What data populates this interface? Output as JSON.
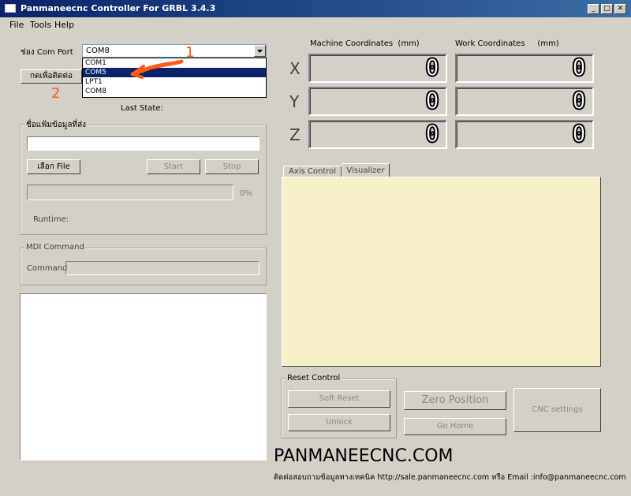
{
  "window": {
    "title": "Panmaneecnc Controller For GRBL 3.4.3"
  },
  "menu": [
    "File",
    "Tools",
    "Help"
  ],
  "connection": {
    "port_label": "ช่อง Com Port",
    "selected_port": "COM8",
    "dropdown_options": [
      "COM1",
      "COM5",
      "LPT1",
      "COM8"
    ],
    "highlighted_index": 1,
    "connect_button": "กดเพื่อติดต่อ",
    "last_state_label": "Last State:",
    "annotation_1": "1",
    "annotation_2": "2"
  },
  "file_group": {
    "legend": "ชื่อแฟ้มข้อมูลที่ส่ง",
    "filename": "",
    "choose_file_button": "เลือก File",
    "start_button": "Start",
    "stop_button": "Stop",
    "progress_text": "0%",
    "progress_value": 0,
    "runtime_label": "Runtime:"
  },
  "mdi": {
    "legend": "MDI Command",
    "command_label": "Command",
    "command_value": ""
  },
  "coordinates": {
    "machine_header": "Machine Coordinates  (mm)",
    "work_header": "Work Coordinates     (mm)",
    "axes": [
      {
        "label": "X",
        "machine": "0",
        "work": "0"
      },
      {
        "label": "Y",
        "machine": "0",
        "work": "0"
      },
      {
        "label": "Z",
        "machine": "0",
        "work": "0"
      }
    ]
  },
  "tabs": {
    "axis_control": "Axis Control",
    "visualizer": "Visualizer",
    "active": "visualizer"
  },
  "colors": {
    "visualizer_bg": "#f5f0c8",
    "annotation": "#ff5a1a",
    "highlight": "#0a246a"
  },
  "reset_control": {
    "legend": "Reset Control",
    "soft_reset": "Soft Reset",
    "unlock": "Unlock",
    "zero_position": "Zero Position",
    "go_home": "Go Home",
    "cnc_settings": "CNC settings"
  },
  "footer": {
    "brand": "PANMANEECNC.COM",
    "contact": "ติดต่อสอบถามข้อมูลทางเทคนิค http://sale.panmaneecnc.com  หรือ Email :info@panmaneecnc.com"
  }
}
